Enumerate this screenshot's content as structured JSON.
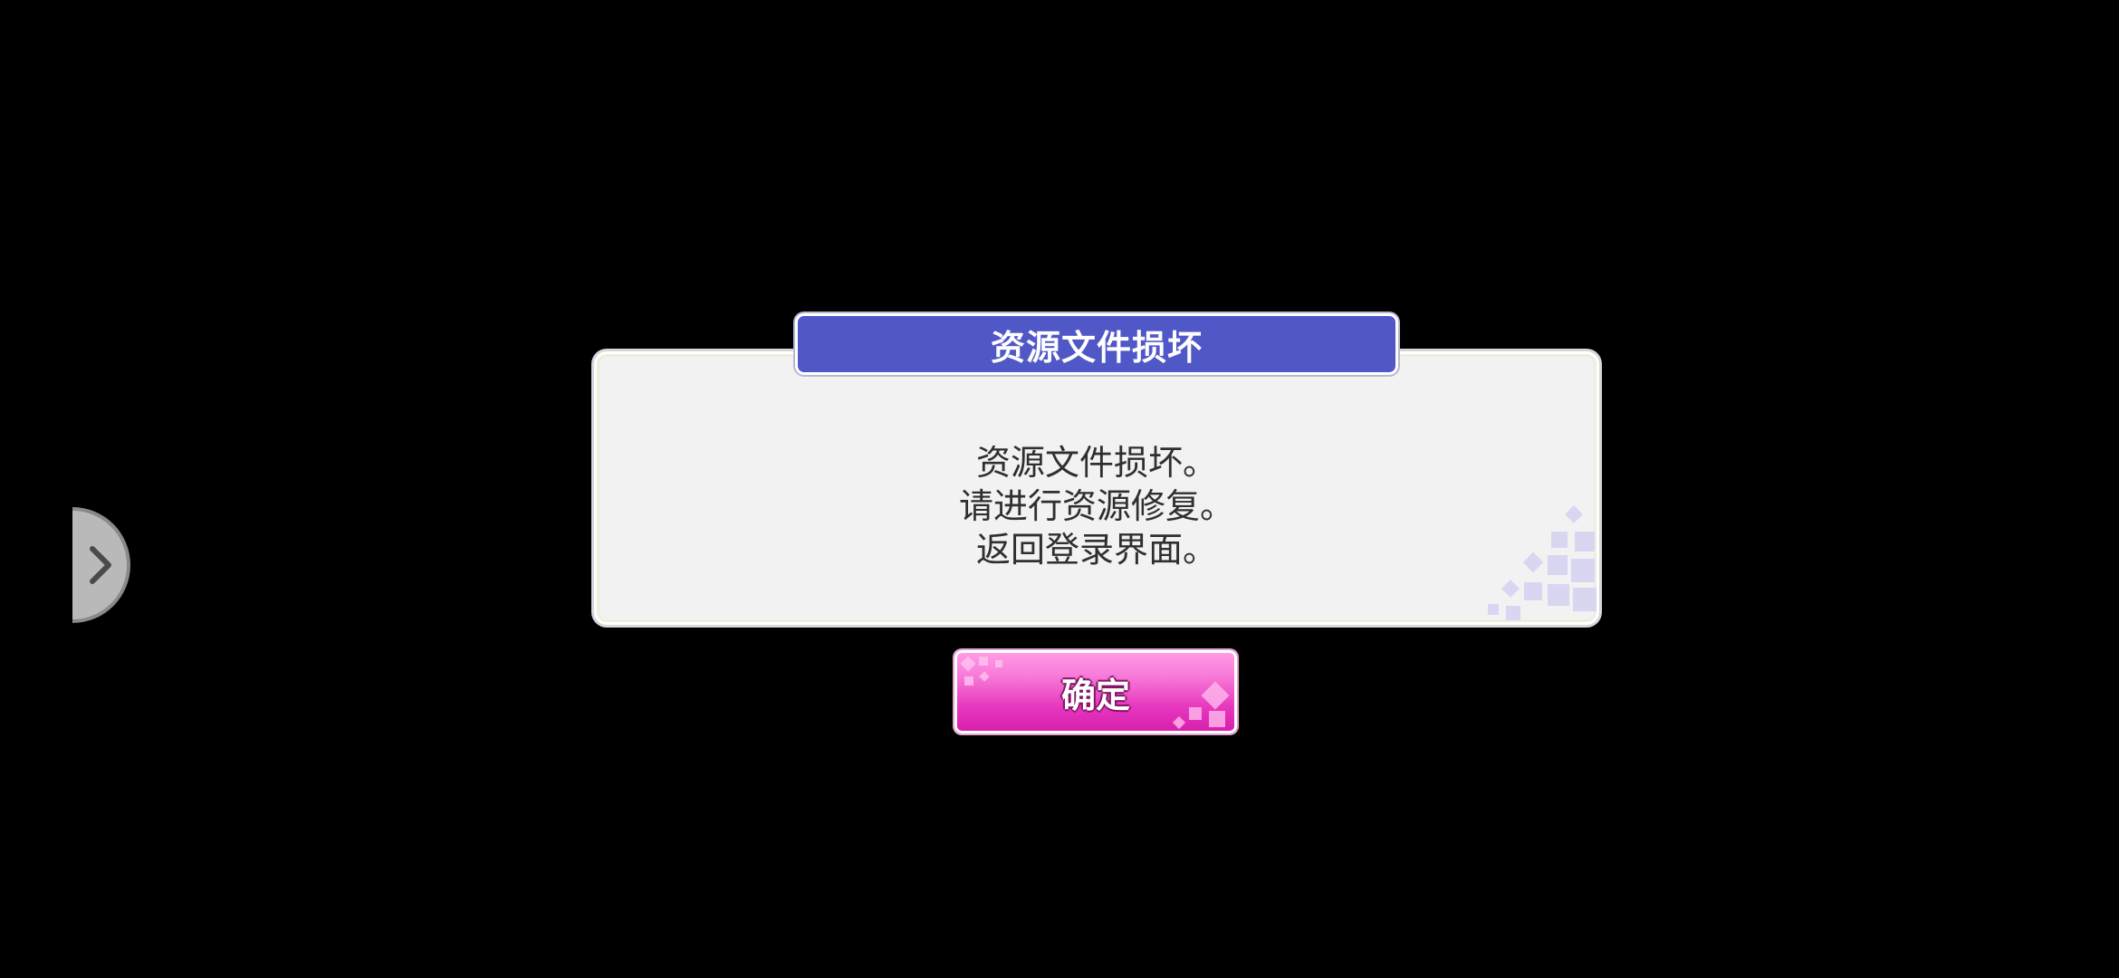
{
  "dialog": {
    "title": "资源文件损坏",
    "message_lines": [
      "资源文件损坏。",
      "请进行资源修复。",
      "返回登录界面。"
    ],
    "confirm_label": "确定"
  },
  "icons": {
    "side_tab": "chevron-right-icon",
    "panel_decoration": "sparkle-pattern-icon",
    "button_decoration": "sparkle-pattern-icon"
  },
  "colors": {
    "background": "#000000",
    "title_banner": "#5058c8",
    "panel": "#f2f2f2",
    "confirm_button": "#e637be",
    "side_tab": "#b9b9b9"
  }
}
